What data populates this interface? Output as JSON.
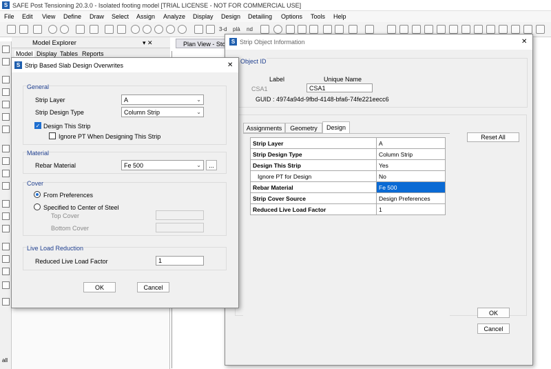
{
  "app": {
    "title": "SAFE Post Tensioning 20.3.0 - Isolated footing model  [TRIAL LICENSE - NOT FOR COMMERCIAL USE]",
    "logo": "S",
    "menu": [
      "File",
      "Edit",
      "View",
      "Define",
      "Draw",
      "Select",
      "Assign",
      "Analyze",
      "Display",
      "Design",
      "Detailing",
      "Options",
      "Tools",
      "Help"
    ],
    "toolbar_texts": [
      "3-d",
      "plà",
      "nd"
    ]
  },
  "explorer": {
    "title": "Model Explorer",
    "pin": "▾ ✕",
    "tabs": [
      "Model",
      "Display",
      "Tables",
      "Reports"
    ]
  },
  "plan_tab": "Plan View - Stor",
  "left_bottom": "all",
  "strip_info": {
    "title": "Strip Object Information",
    "close": "✕",
    "object_id_title": "Object ID",
    "label_header": "Label",
    "unique_header": "Unique Name",
    "label_value": "CSA1",
    "unique_value": "CSA1",
    "guid": "GUID : 4974a94d-9fbd-4148-bfa6-74fe221eecc6",
    "tabs": [
      "Assignments",
      "Geometry",
      "Design"
    ],
    "active_tab": "Design",
    "rows": [
      {
        "key": "Strip Layer",
        "value": "A"
      },
      {
        "key": "Strip Design Type",
        "value": "Column Strip"
      },
      {
        "key": "Design This Strip",
        "value": "Yes"
      },
      {
        "key": "Ignore PT for Design",
        "value": "No"
      },
      {
        "key": "Rebar Material",
        "value": "Fe 500"
      },
      {
        "key": "Strip Cover Source",
        "value": "Design Preferences"
      },
      {
        "key": "Reduced Live Load Factor",
        "value": "1"
      }
    ],
    "reset_all": "Reset All",
    "ok": "OK",
    "cancel": "Cancel"
  },
  "overwrites": {
    "title": "Strip Based Slab Design Overwrites",
    "close": "✕",
    "general": {
      "title": "General",
      "strip_layer_label": "Strip Layer",
      "strip_layer_value": "A",
      "strip_design_type_label": "Strip Design Type",
      "strip_design_type_value": "Column Strip",
      "design_this_strip_label": "Design This Strip",
      "design_this_strip_checked": true,
      "ignore_pt_label": "Ignore PT When Designing This Strip",
      "ignore_pt_checked": false
    },
    "material": {
      "title": "Material",
      "rebar_label": "Rebar Material",
      "rebar_value": "Fe 500",
      "browse": "..."
    },
    "cover": {
      "title": "Cover",
      "from_prefs_label": "From Preferences",
      "specified_label": "Specified to Center of Steel",
      "selected": "From Preferences",
      "top_cover_label": "Top Cover",
      "bottom_cover_label": "Bottom Cover"
    },
    "live_load": {
      "title": "Live Load Reduction",
      "factor_label": "Reduced Live Load Factor",
      "factor_value": "1"
    },
    "ok": "OK",
    "cancel": "Cancel"
  }
}
